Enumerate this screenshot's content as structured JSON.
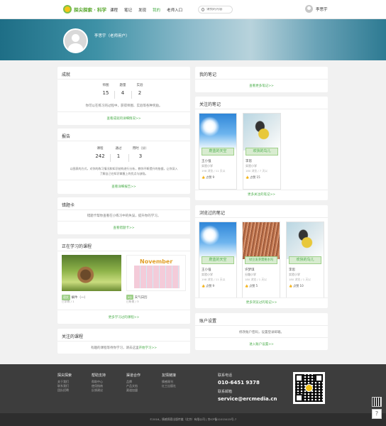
{
  "nav": {
    "logo_text": "探尖探索 · 科学",
    "items": [
      {
        "label": "课程",
        "active": false
      },
      {
        "label": "笔记",
        "active": false
      },
      {
        "label": "发现",
        "active": false
      },
      {
        "label": "我的",
        "active": true
      },
      {
        "label": "老师入口",
        "active": false
      }
    ],
    "search_placeholder": "请找的内容",
    "user_name": "李思宇"
  },
  "banner": {
    "name": "李思宇（老师用户）"
  },
  "achievements": {
    "title": "成就",
    "stats": [
      {
        "label": "师图",
        "value": "15"
      },
      {
        "label": "题量",
        "value": "4"
      },
      {
        "label": "实验",
        "value": "2"
      }
    ],
    "desc": "你可以在练习的过程中，获得师图、实验等各种奖励。",
    "link": "查看成就的详细情况>>"
  },
  "report": {
    "title": "报告",
    "stats": [
      {
        "label": "课程",
        "value": "242"
      },
      {
        "label": "通过",
        "value": "1"
      },
      {
        "label": "用时（分）",
        "value": "3"
      }
    ],
    "desc1": "以图表的方式，对你的练习情况和知识结构进行分析，教你不断提升的依据，让你深入",
    "desc2": "了解自己在知识掌握上的优点与缺陷。",
    "link": "查看详细报告>>"
  },
  "mistakes": {
    "title": "错题卡",
    "desc": "错题卡帮你查看在小练习中的失误，提升你的学习。",
    "link": "查看错题卡>>"
  },
  "courses": {
    "title": "正在学习的课程",
    "items": [
      {
        "tag": "语文",
        "name": "蜗牛（一）",
        "sub": "已学练 / 1"
      },
      {
        "tag": "XQ",
        "name": "天气日历",
        "sub": "已听收 / 3"
      }
    ],
    "calendar_title": "November",
    "link": "更多学习过的课程>>"
  },
  "followed_courses": {
    "title": "关注的课程",
    "desc": "有趣的课程等待你学习，请去这里",
    "desc_link": "开始学习>>"
  },
  "my_notes": {
    "title": "我的笔记",
    "link": "查看更多笔记>>"
  },
  "followed_notes": {
    "title": "关注的笔记",
    "items": [
      {
        "caption": "蔚蓝的天空",
        "author": "王小强",
        "school": "实验小学",
        "meta": "198 浏览 / 11 天以",
        "likes": "9"
      },
      {
        "caption": "欢快的鸟儿",
        "author": "李思",
        "school": "实验小学",
        "meta": "180 浏览 / 7 天以",
        "likes": "15"
      }
    ],
    "like_label": "点赞",
    "link": "更多关注的笔记>>"
  },
  "viewed_notes": {
    "title": "浏览过的笔记",
    "items": [
      {
        "caption": "蔚蓝的天空",
        "author": "王小强",
        "school": "实验小学",
        "meta": "198 浏览 / 11 天以",
        "likes": "9"
      },
      {
        "caption": "绿豆发芽需要水吗",
        "author": "许梦琪",
        "school": "分路小学",
        "meta": "180 浏览 / 1 天以",
        "likes": "5"
      },
      {
        "caption": "欢快的鸟儿",
        "author": "李思",
        "school": "实验小学",
        "meta": "180 浏览 / 1 天以",
        "likes": "10"
      }
    ],
    "like_label": "点赞",
    "link": "更多浏览过的笔记>>"
  },
  "account": {
    "title": "账户设置",
    "desc": "修改账户密码，设置登录邮箱。",
    "link": "进入账户设置>>"
  },
  "footer": {
    "cols": [
      {
        "title": "探尖探索",
        "items": [
          "关于我们",
          "联系我们",
          "团队招聘"
        ]
      },
      {
        "title": "帮助支持",
        "items": [
          "帮助中心",
          "使用指南",
          "反馈建议"
        ]
      },
      {
        "title": "渠道合作",
        "items": [
          "品牌",
          "产品文档",
          "渠道加盟"
        ]
      },
      {
        "title": "友情链接",
        "items": [
          "情感周刊",
          "红工出版社"
        ]
      }
    ],
    "phone_label": "联系电话",
    "phone": "010-6451 9378",
    "email_label": "联系邮箱",
    "email": "service@ercmedia.cn",
    "copyright": "©2016，情感探索出版传媒（北京）有限公司 | 京ICP备11015415号-7"
  },
  "colors": {
    "accent": "#4cae4c",
    "footer_bg": "#3d3d3d"
  }
}
